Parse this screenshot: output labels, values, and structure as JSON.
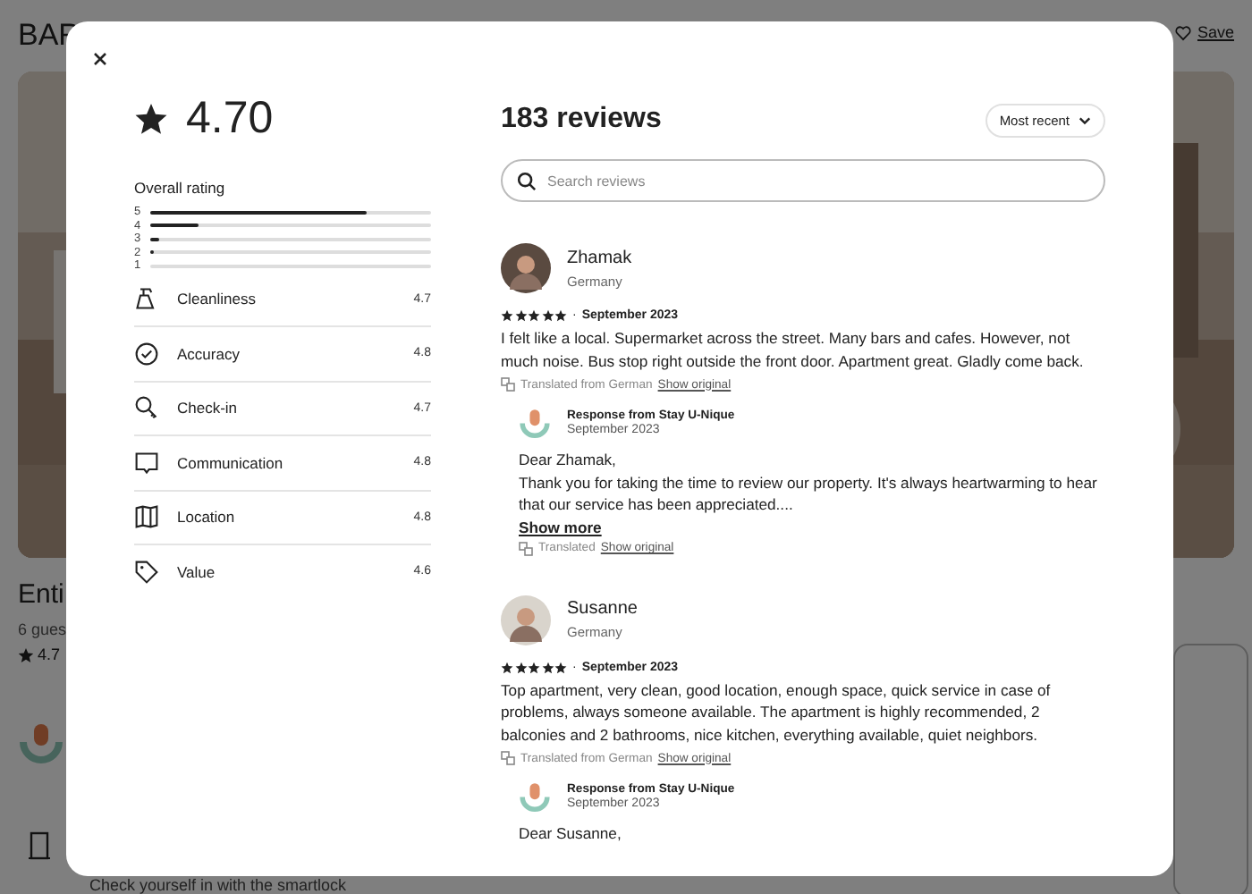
{
  "background": {
    "title": "BAR",
    "save": "Save",
    "listing_title": "Enti",
    "guests": "6 gues",
    "rating": "4.7",
    "feature": "Check yourself in with the smartlock"
  },
  "modal": {
    "rating": "4.70",
    "overall_label": "Overall rating",
    "distribution": [
      {
        "label": "5",
        "level": 0.77
      },
      {
        "label": "4",
        "level": 0.17
      },
      {
        "label": "3",
        "level": 0.03
      },
      {
        "label": "2",
        "level": 0.015
      },
      {
        "label": "1"
      }
    ],
    "categories": [
      {
        "name": "Cleanliness",
        "score": "4.7"
      },
      {
        "name": "Accuracy",
        "score": "4.8"
      },
      {
        "name": "Check-in",
        "score": "4.7"
      },
      {
        "name": "Communication",
        "score": "4.8"
      },
      {
        "name": "Location",
        "score": "4.8"
      },
      {
        "name": "Value",
        "score": "4.6"
      }
    ],
    "reviews_title": "183 reviews",
    "sort": "Most recent",
    "search": {
      "placeholder": "Search reviews"
    },
    "reviews": [
      {
        "name": "Zhamak",
        "country": "Germany",
        "stars": 5,
        "separator": "·",
        "date": "September 2023",
        "text": "I felt like a local. Supermarket across the street. Many bars and cafes. However, not much noise. Bus stop right outside the front door. Apartment great. Gladly come back.",
        "translated": "Translated from German",
        "show_original": "Show original",
        "response": {
          "from": "Response from Stay U-Nique",
          "date": "September 2023",
          "text": "Dear Zhamak,\nThank you for taking the time to review our property. It's always heartwarming to hear that our service has been appreciated....",
          "show_more": "Show more",
          "translated": "Translated",
          "show_original": "Show original"
        }
      },
      {
        "name": "Susanne",
        "country": "Germany",
        "stars": 5,
        "separator": "·",
        "date": "September 2023",
        "text": "Top apartment, very clean, good location, enough space, quick service in case of problems, always someone available. The apartment is highly recommended, 2 balconies and 2 bathrooms, nice kitchen, everything available, quiet neighbors.",
        "translated": "Translated from German",
        "show_original": "Show original",
        "response": {
          "from": "Response from Stay U-Nique",
          "date": "September 2023",
          "text": "Dear Susanne,"
        }
      }
    ]
  }
}
